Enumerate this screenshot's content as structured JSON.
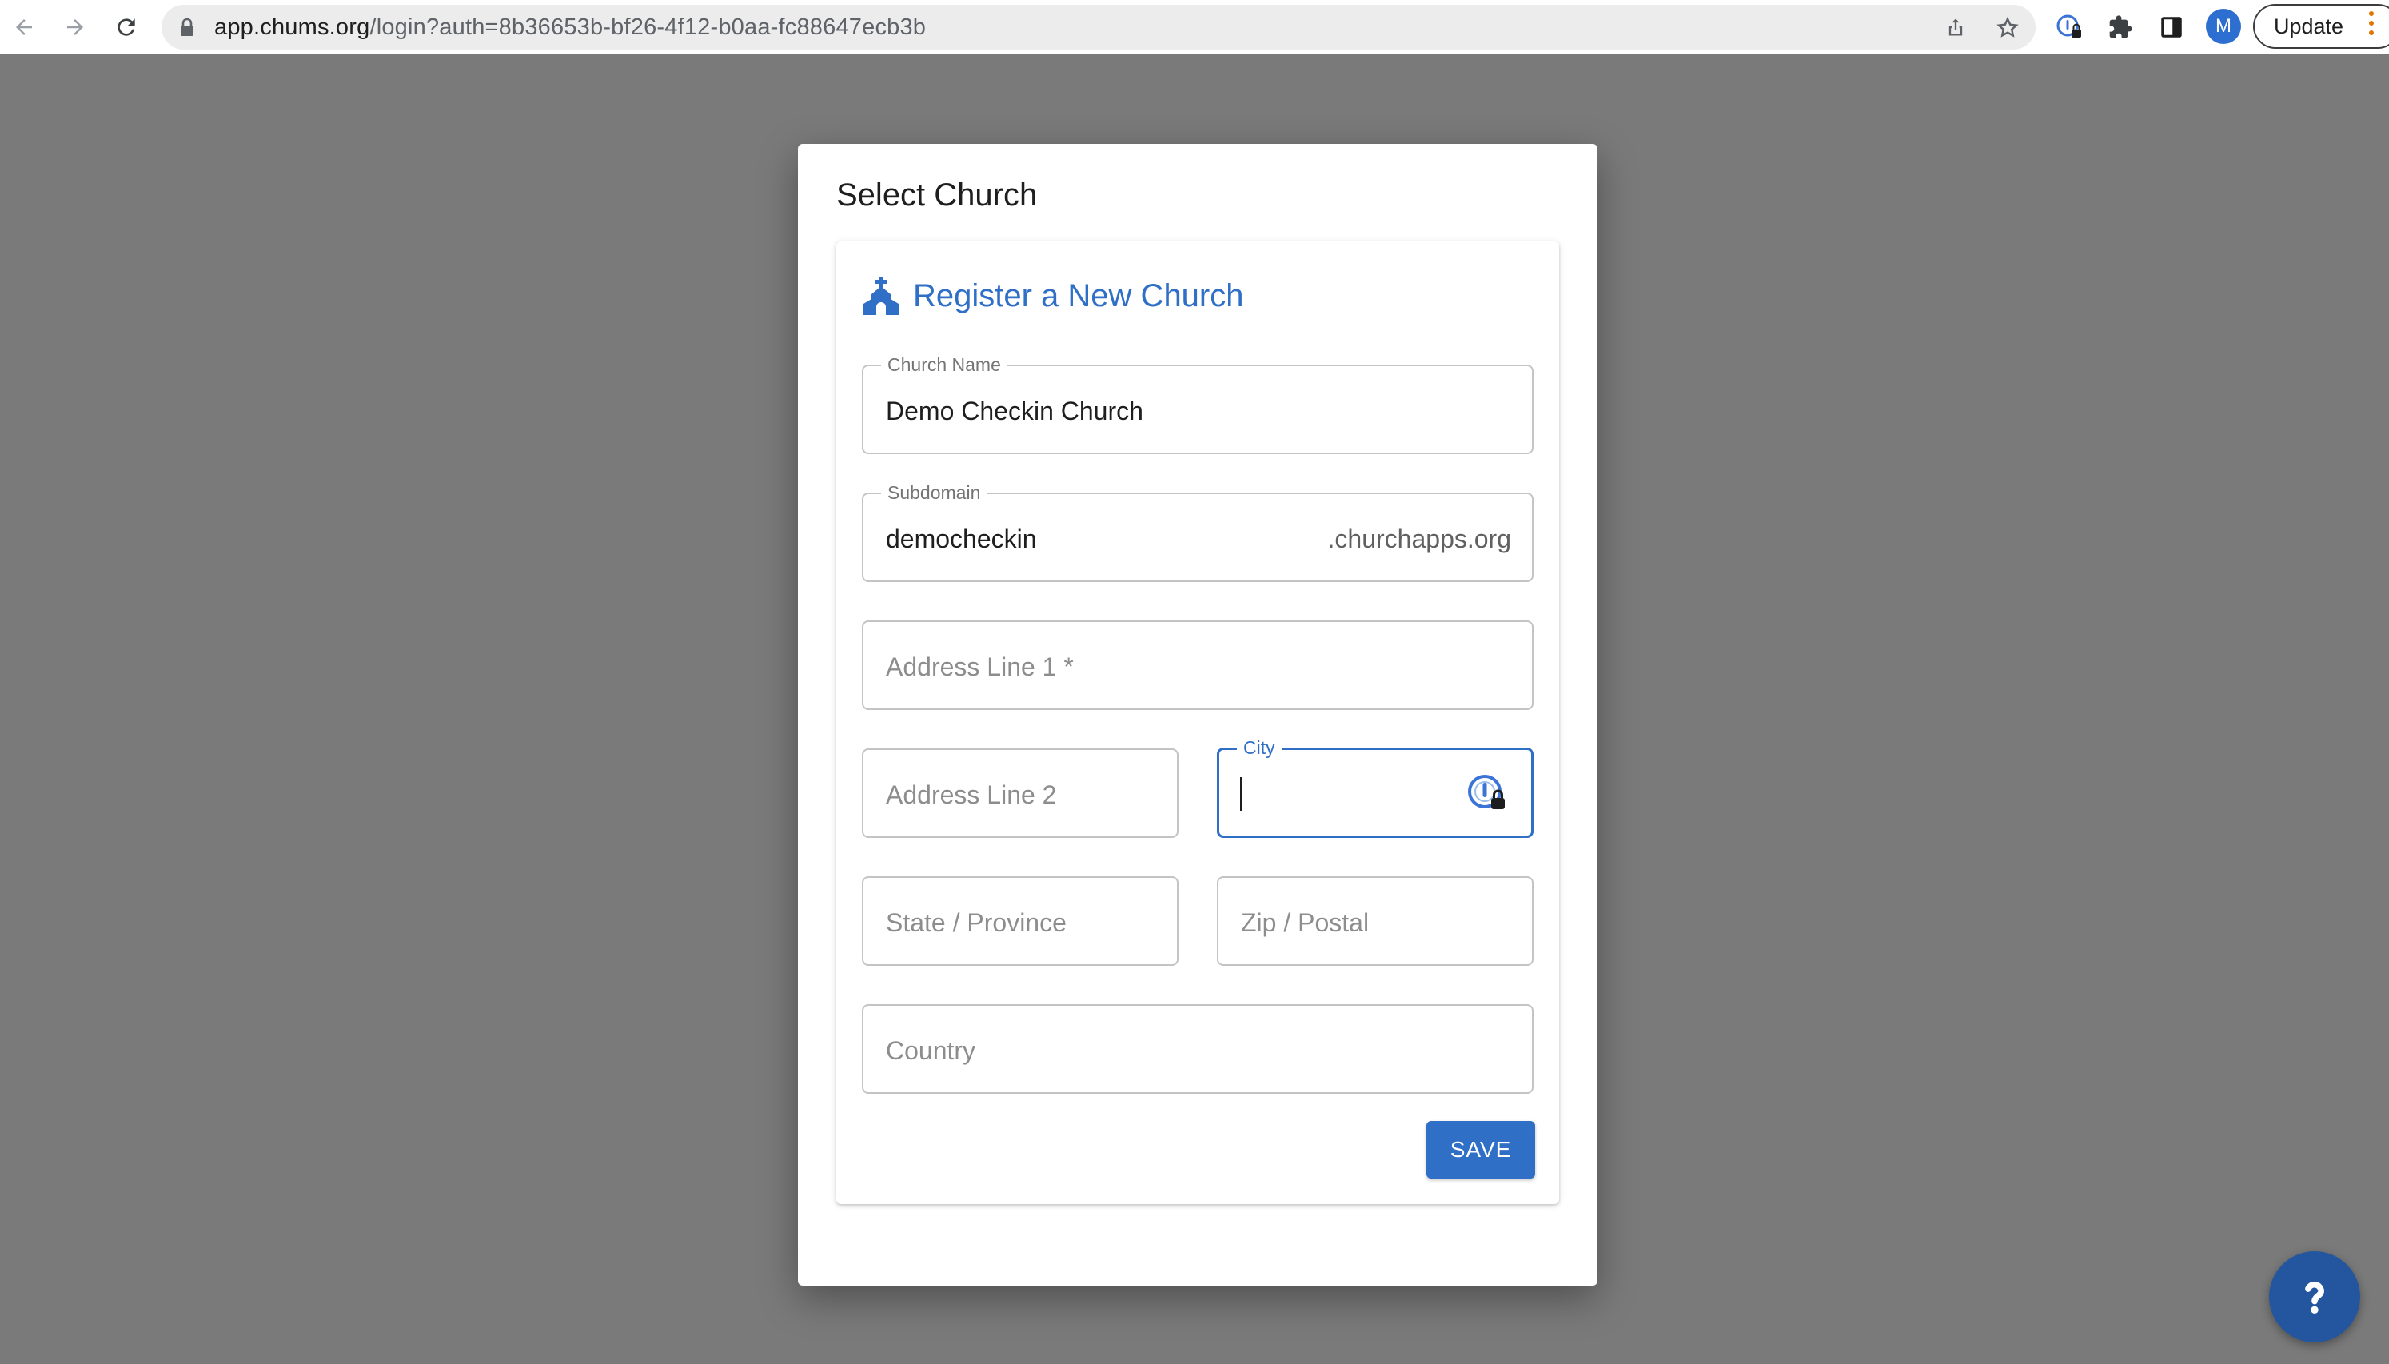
{
  "browser": {
    "url_host": "app.chums.org",
    "url_path": "/login?auth=8b36653b-bf26-4f12-b0aa-fc88647ecb3b",
    "avatar_letter": "M",
    "update_label": "Update",
    "icons": [
      "back-arrow-icon",
      "forward-arrow-icon",
      "reload-icon",
      "lock-icon",
      "share-icon",
      "bookmark-star-icon",
      "password-manager-icon",
      "extensions-puzzle-icon",
      "side-panel-icon"
    ]
  },
  "modal": {
    "title": "Select Church",
    "card_title": "Register a New Church",
    "fields": {
      "church_name": {
        "label": "Church Name",
        "value": "Demo Checkin Church"
      },
      "subdomain": {
        "label": "Subdomain",
        "value": "democheckin",
        "suffix": ".churchapps.org"
      },
      "address1": {
        "placeholder": "Address Line 1 *"
      },
      "address2": {
        "placeholder": "Address Line 2"
      },
      "city": {
        "label": "City",
        "value": ""
      },
      "state": {
        "placeholder": "State / Province"
      },
      "zip": {
        "placeholder": "Zip / Postal"
      },
      "country": {
        "placeholder": "Country"
      }
    },
    "save_label": "SAVE"
  },
  "colors": {
    "primary": "#2f6fc6",
    "overlay": "#7a7a7a",
    "help_fab": "#23569e"
  }
}
